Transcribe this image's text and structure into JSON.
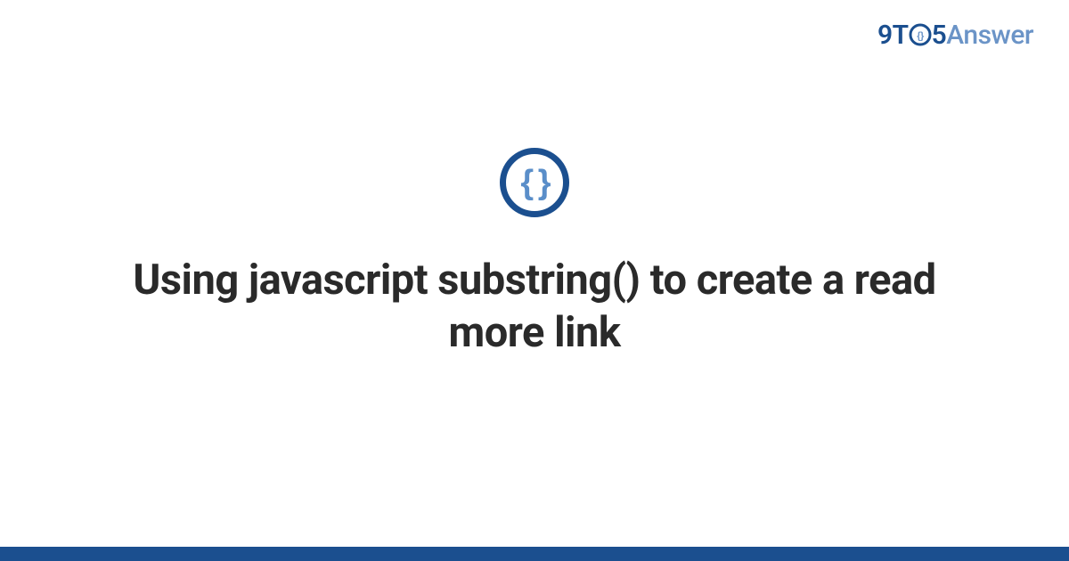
{
  "logo": {
    "part1": "9T",
    "part2": "5",
    "part3": "Answer"
  },
  "title": "Using javascript substring() to create a read more link",
  "icon": {
    "name": "code-braces-icon",
    "glyph": "{ }"
  },
  "colors": {
    "brand_dark": "#1b4f8f",
    "brand_light": "#6b94c7",
    "accent": "#5a8ec9",
    "text": "#2a2a2a"
  }
}
